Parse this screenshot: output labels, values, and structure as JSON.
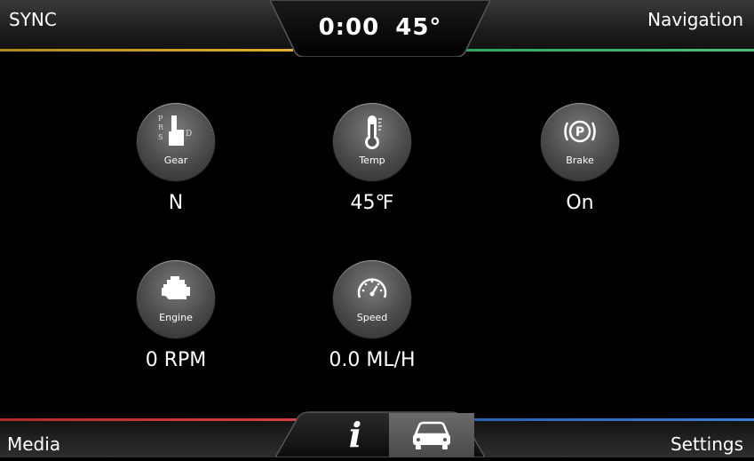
{
  "header": {
    "left_label": "SYNC",
    "right_label": "Navigation",
    "time": "0:00",
    "temperature": "45°",
    "left_accent": "#e0b030",
    "right_accent": "#4ac07a"
  },
  "items": [
    {
      "label": "Gear",
      "value": "N",
      "icon": "gear-shift-icon"
    },
    {
      "label": "Temp",
      "value": "45℉",
      "icon": "thermometer-icon"
    },
    {
      "label": "Brake",
      "value": "On",
      "icon": "parking-brake-icon"
    },
    {
      "label": "Engine",
      "value": "0 RPM",
      "icon": "engine-icon"
    },
    {
      "label": "Speed",
      "value": "0.0 ML/H",
      "icon": "speedometer-icon"
    }
  ],
  "gear_letters": {
    "p": "P",
    "r": "R",
    "s": "S",
    "d": "D"
  },
  "brake_letter": "P",
  "footer": {
    "left_label": "Media",
    "right_label": "Settings",
    "info_glyph": "i",
    "left_accent": "#d84040",
    "right_accent": "#3a80d8",
    "tabs": [
      {
        "name": "info",
        "icon": "info-icon",
        "selected": false
      },
      {
        "name": "vehicle",
        "icon": "car-icon",
        "selected": true
      }
    ]
  }
}
